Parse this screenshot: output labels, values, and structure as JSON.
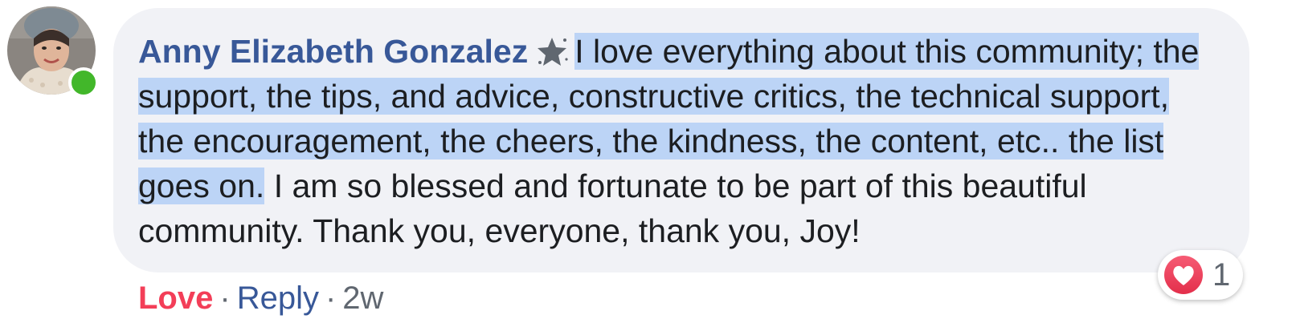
{
  "comment": {
    "author": "Anny Elizabeth Gonzalez",
    "author_badge": "star-badge-icon",
    "text_highlighted": "I love everything about this community; the support, the tips, and advice, constructive critics, the technical support, the encouragement, the cheers, the kindness, the content, etc.. the list goes on.",
    "text_rest": " I am so blessed and fortunate to be part of this beautiful community. Thank you, everyone, thank you, Joy!",
    "online": true
  },
  "actions": {
    "love_label": "Love",
    "reply_label": "Reply",
    "separator": "·",
    "timestamp": "2w"
  },
  "reactions": {
    "type": "love",
    "count": "1"
  },
  "colors": {
    "author": "#385898",
    "love": "#f33e58",
    "highlight": "#bcd4f6",
    "bubble": "#f1f2f6",
    "online": "#42b72a"
  }
}
